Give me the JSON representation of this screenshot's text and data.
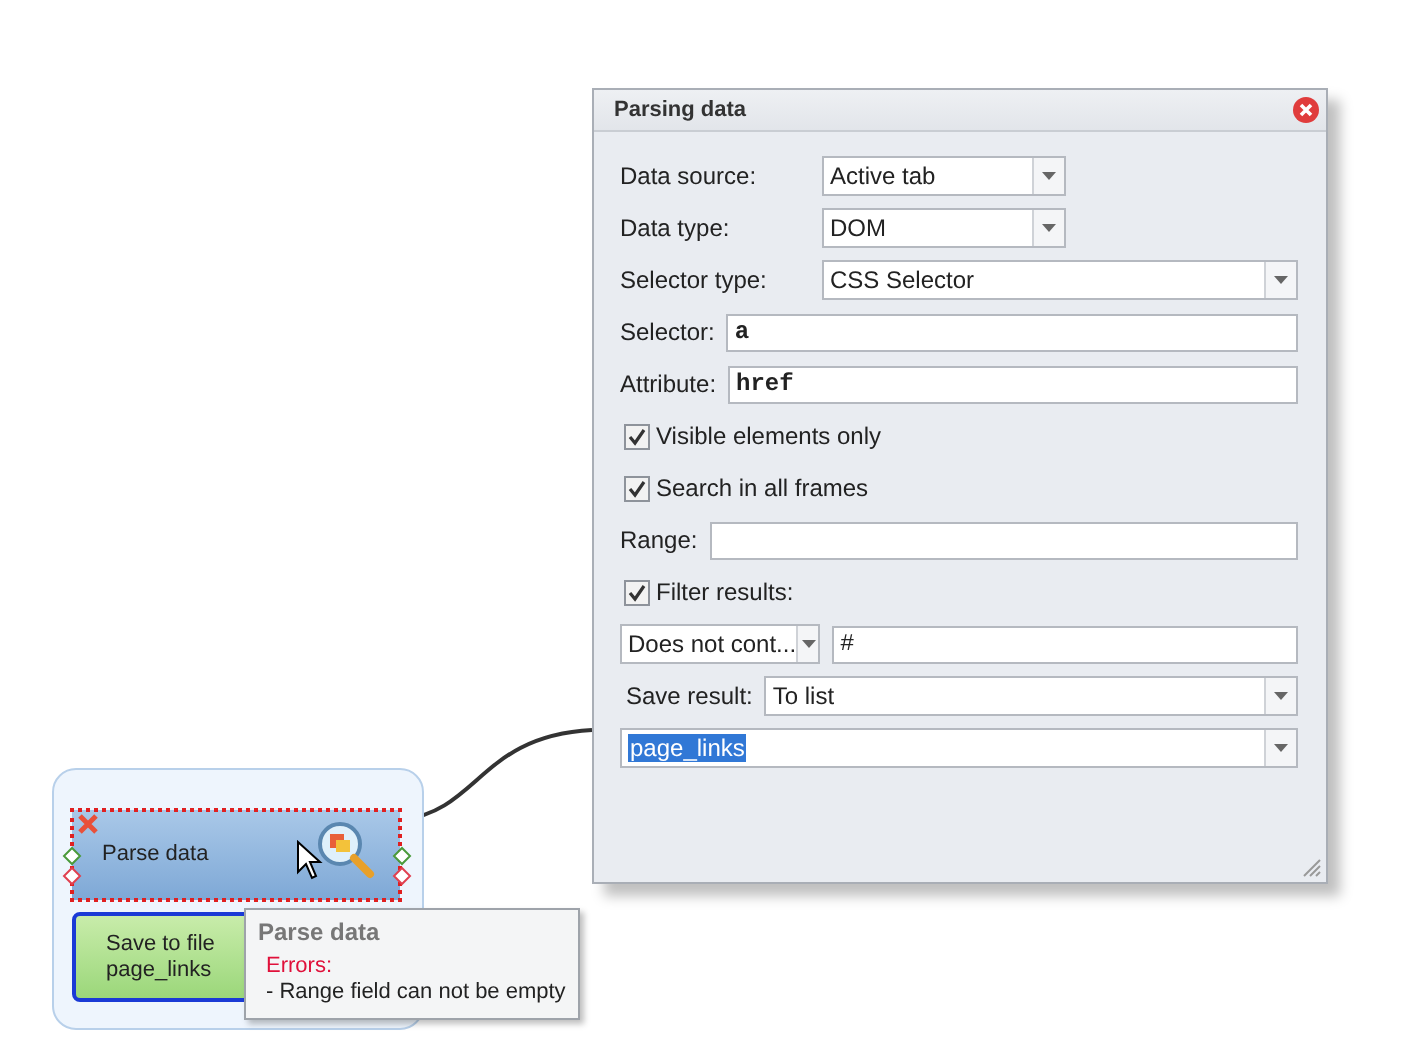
{
  "dialog": {
    "title": "Parsing data",
    "rows": [
      {
        "kind": "short-combo",
        "label": "Data source:",
        "value": "Active tab"
      },
      {
        "kind": "short-combo",
        "label": "Data type:",
        "value": "DOM"
      },
      {
        "kind": "combo",
        "label": "Selector type:",
        "value": "CSS Selector"
      },
      {
        "kind": "text",
        "label": "Selector:",
        "value": "a"
      },
      {
        "kind": "text",
        "label": "Attribute:",
        "value": "href"
      },
      {
        "kind": "check",
        "label": "Visible elements only",
        "checked": true
      },
      {
        "kind": "check",
        "label": "Search in all frames",
        "checked": true
      },
      {
        "kind": "text",
        "label": "Range:",
        "value": ""
      },
      {
        "kind": "check",
        "label": "Filter results:",
        "checked": true
      },
      {
        "kind": "filter",
        "value": "Does not cont...",
        "text": "#"
      },
      {
        "kind": "inline-combo",
        "label": "Save result:",
        "value": "To list"
      },
      {
        "kind": "selected-combo",
        "value": "page_links"
      }
    ]
  },
  "group": {
    "nodes": [
      {
        "kind": "action",
        "label": "Parse data",
        "error": true,
        "selected": false
      },
      {
        "kind": "save",
        "label": "Save to file",
        "sub": "page_links",
        "error": false,
        "selected": true
      }
    ]
  },
  "tooltip": {
    "title": "Parse data",
    "error_heading": "Errors:",
    "message": "- Range field can not be empty"
  }
}
